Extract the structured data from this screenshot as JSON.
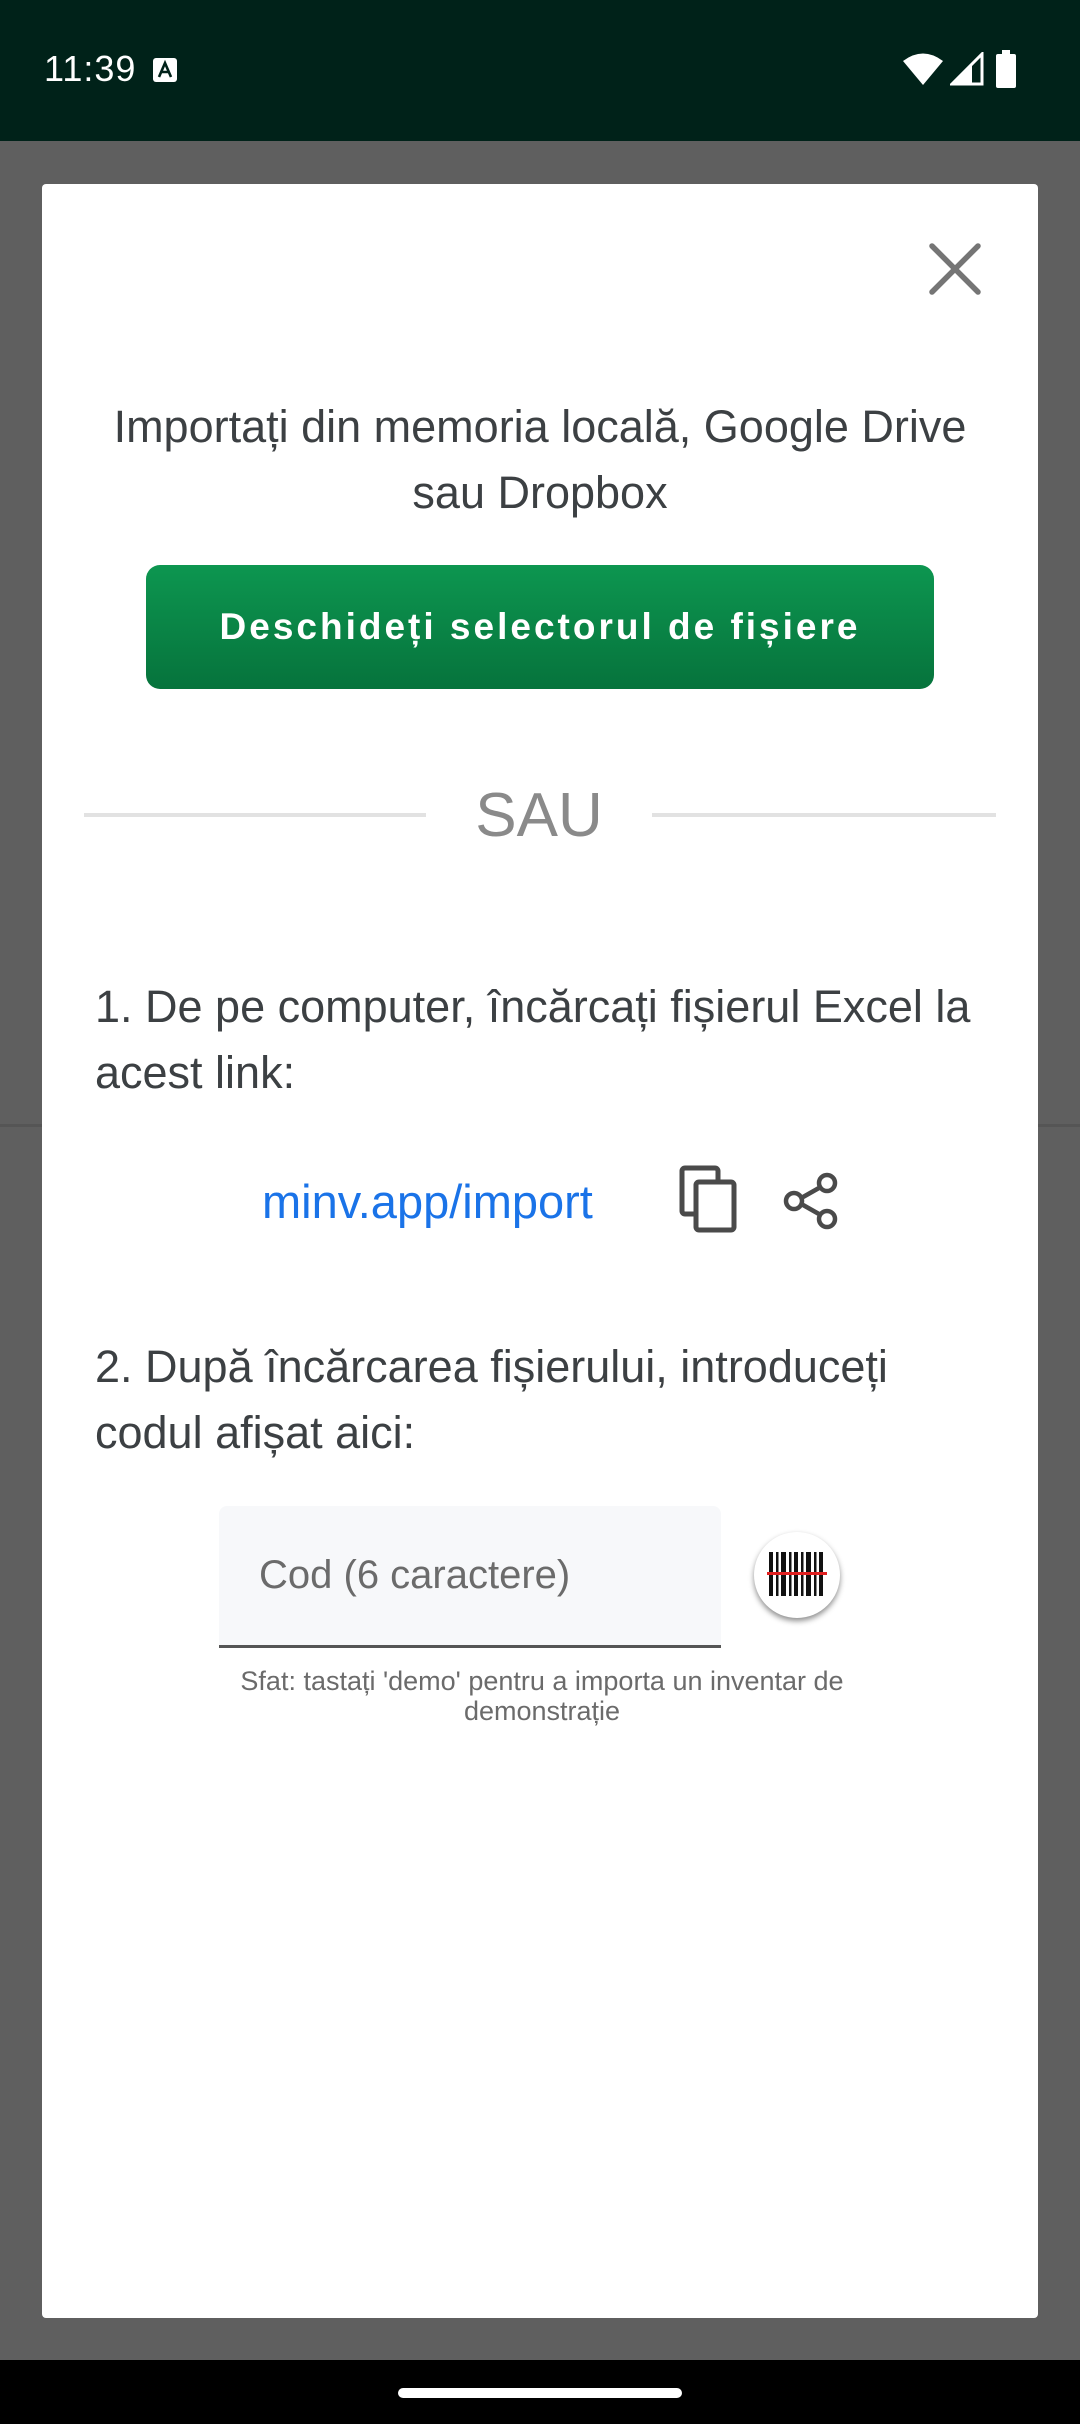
{
  "status_bar": {
    "time": "11:39",
    "icons": [
      "keyboard-a-icon",
      "wifi-icon",
      "signal-icon",
      "battery-icon"
    ]
  },
  "dialog": {
    "close_icon": "close-icon",
    "heading": "Importați din memoria locală, Google Drive sau Dropbox",
    "open_picker_label": "Deschideți selectorul de fișiere",
    "or_label": "SAU",
    "step1": "1. De pe computer, încărcați fișierul Excel la acest link:",
    "link": "minv.app/import",
    "copy_icon": "copy-icon",
    "share_icon": "share-icon",
    "step2": "2. După încărcarea fișierului, introduceți codul afișat aici:",
    "code_placeholder": "Cod (6 caractere)",
    "barcode_icon": "barcode-scan-icon",
    "tip": "Sfat: tastați 'demo' pentru a importa un inventar de demonstrație"
  },
  "colors": {
    "status_bar": "#002219",
    "primary_button": "#0a8a48",
    "link": "#1a73e8",
    "scrim": "#5f5f5f"
  }
}
